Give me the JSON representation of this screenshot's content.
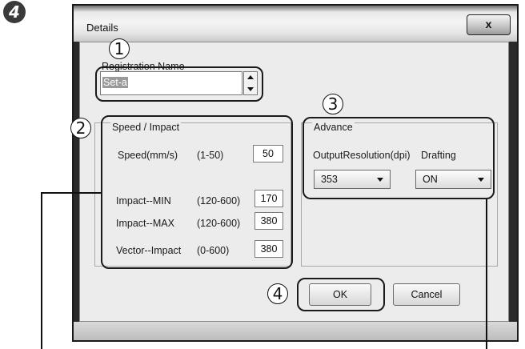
{
  "step_badge": "4",
  "window": {
    "title": "Details",
    "close_glyph": "x"
  },
  "callouts": [
    "1",
    "2",
    "3",
    "4"
  ],
  "registration": {
    "label": "Registration Name",
    "value": "Set-a"
  },
  "speed_impact": {
    "title": "Speed / Impact",
    "rows": [
      {
        "label": "Speed(mm/s)",
        "range": "(1-50)",
        "value": "50"
      },
      {
        "label": "Impact--MIN",
        "range": "(120-600)",
        "value": "170"
      },
      {
        "label": "Impact--MAX",
        "range": "(120-600)",
        "value": "380"
      },
      {
        "label": "Vector--Impact",
        "range": "(0-600)",
        "value": "380"
      }
    ]
  },
  "advance": {
    "title": "Advance",
    "output_resolution": {
      "label": "OutputResolution(dpi)",
      "value": "353"
    },
    "drafting": {
      "label": "Drafting",
      "value": "ON"
    }
  },
  "buttons": {
    "ok": "OK",
    "cancel": "Cancel"
  }
}
